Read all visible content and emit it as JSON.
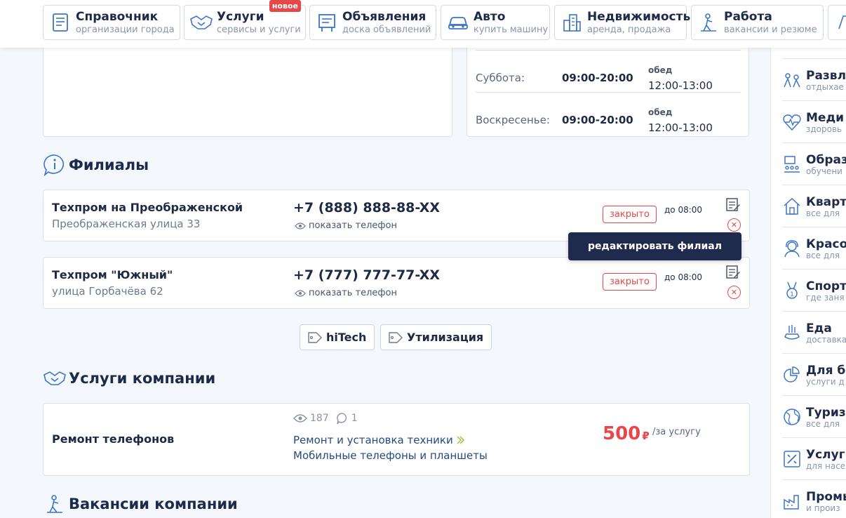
{
  "nav": [
    {
      "title": "Справочник",
      "sub": "организации города",
      "icon": "directory-icon"
    },
    {
      "title": "Услуги",
      "sub": "сервисы и услуги",
      "icon": "handshake-icon",
      "badge": "новое"
    },
    {
      "title": "Объявления",
      "sub": "доска объявлений",
      "icon": "board-icon"
    },
    {
      "title": "Авто",
      "sub": "купить машину",
      "icon": "car-icon"
    },
    {
      "title": "Недвижимость",
      "sub": "аренда, продажа",
      "icon": "buildings-icon"
    },
    {
      "title": "Работа",
      "sub": "вакансии и резюме",
      "icon": "worker-icon"
    }
  ],
  "hours": [
    {
      "day": "Суббота:",
      "time": "09:00-20:00",
      "lunch_label": "обед",
      "lunch": "12:00-13:00"
    },
    {
      "day": "Воскресенье:",
      "time": "09:00-20:00",
      "lunch_label": "обед",
      "lunch": "12:00-13:00"
    }
  ],
  "branches_heading": "Филиалы",
  "branches": [
    {
      "name": "Техпром на Преображенской",
      "address": "Преображенская улица 33",
      "phone": "+7 (888) 888-88-XX",
      "show_phone": "показать телефон",
      "status": "закрыто",
      "until": "до 08:00"
    },
    {
      "name": "Техпром \"Южный\"",
      "address": "улица Горбачёва 62",
      "phone": "+7 (777) 777-77-XX",
      "show_phone": "показать телефон",
      "status": "закрыто",
      "until": "до 08:00"
    }
  ],
  "tooltip": "редактировать филиал",
  "tags": [
    "hiTech",
    "Утилизация"
  ],
  "services_heading": "Услуги компании",
  "service": {
    "name": "Ремонт телефонов",
    "views": "187",
    "comments": "1",
    "category1": "Ремонт и установка техники",
    "category2": "Мобильные телефоны и планшеты",
    "price": "500",
    "currency": "₽",
    "per": "/за услугу"
  },
  "vacancies_heading": "Вакансии компании",
  "sidebar": [
    {
      "t1": "Развле",
      "t2": "отдыхае"
    },
    {
      "t1": "Меди",
      "t2": "здоровь"
    },
    {
      "t1": "Образ",
      "t2": "обучени"
    },
    {
      "t1": "Кварт",
      "t2": "все для"
    },
    {
      "t1": "Красо",
      "t2": "все для"
    },
    {
      "t1": "Спорт",
      "t2": "где заня"
    },
    {
      "t1": "Еда",
      "t2": "доставка"
    },
    {
      "t1": "Для би",
      "t2": "услуги д"
    },
    {
      "t1": "Туризм",
      "t2": "все для"
    },
    {
      "t1": "Услуги",
      "t2": "для насе"
    },
    {
      "t1": "Промы",
      "t2": "и произ"
    }
  ],
  "colors": {
    "accent": "#e8474a",
    "navy": "#1f2a4d",
    "link": "#244a82",
    "icon": "#3b75c8"
  }
}
